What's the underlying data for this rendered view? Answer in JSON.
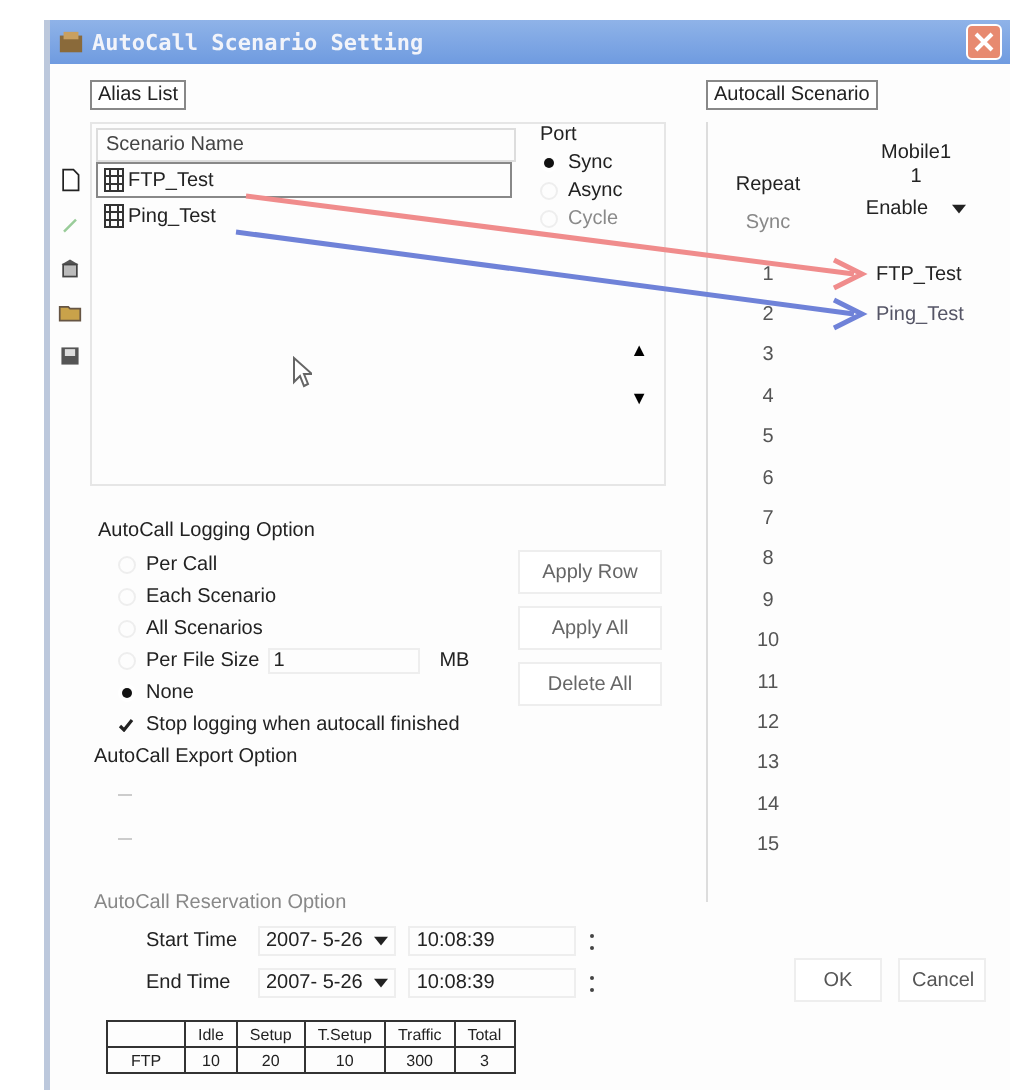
{
  "window": {
    "title": "AutoCall Scenario Setting"
  },
  "alias_list": {
    "label": "Alias List",
    "header": "Scenario Name",
    "items": [
      {
        "name": "FTP_Test",
        "selected": true
      },
      {
        "name": "Ping_Test",
        "selected": false
      }
    ]
  },
  "port": {
    "label": "Port",
    "options": [
      {
        "label": "Sync",
        "selected": true,
        "disabled": false
      },
      {
        "label": "Async",
        "selected": false,
        "disabled": false
      },
      {
        "label": "Cycle",
        "selected": false,
        "disabled": true
      }
    ]
  },
  "move_buttons": [
    "▲",
    "▼"
  ],
  "logging": {
    "title": "AutoCall Logging Option",
    "options": [
      {
        "label": "Per Call",
        "selected": false,
        "kind": "plain"
      },
      {
        "label": "Each Scenario",
        "selected": false,
        "kind": "plain"
      },
      {
        "label": "All Scenarios",
        "selected": false,
        "kind": "plain"
      },
      {
        "label": "Per File Size",
        "selected": false,
        "kind": "size"
      },
      {
        "label": "None",
        "selected": true,
        "kind": "plain"
      }
    ],
    "file_size": "1",
    "unit": "MB",
    "stop_logging": {
      "label": "Stop logging when autocall finished",
      "checked": true
    }
  },
  "row_buttons": [
    "Apply Row",
    "Apply All",
    "Delete All"
  ],
  "export": {
    "title": "AutoCall Export Option",
    "options": [
      {
        "selected": false
      },
      {
        "selected": false
      }
    ]
  },
  "reservation": {
    "title": "AutoCall Reservation Option",
    "rows": [
      {
        "label": "Start Time",
        "checked": false,
        "date": "2007- 5-26",
        "time": "10:08:39"
      },
      {
        "label": "End Time",
        "checked": false,
        "date": "2007- 5-26",
        "time": "10:08:39"
      }
    ]
  },
  "stats_table": {
    "columns": [
      "Idle",
      "Setup",
      "T.Setup",
      "Traffic",
      "Total"
    ],
    "rows": [
      {
        "label": "FTP",
        "cells": [
          "10",
          "20",
          "10",
          "300",
          "3"
        ]
      }
    ]
  },
  "scenario": {
    "label": "Autocall Scenario",
    "device": "Mobile1",
    "device_number": "1",
    "repeat_label": "Repeat",
    "mode": "Sync",
    "state": "Enable",
    "rows": [
      {
        "number": "1",
        "name": "FTP_Test"
      },
      {
        "number": "2",
        "name": "Ping_Test"
      },
      {
        "number": "3"
      },
      {
        "number": "4"
      },
      {
        "number": "5"
      },
      {
        "number": "6"
      },
      {
        "number": "7"
      },
      {
        "number": "8"
      },
      {
        "number": "9"
      },
      {
        "number": "10"
      },
      {
        "number": "11"
      },
      {
        "number": "12"
      },
      {
        "number": "13"
      },
      {
        "number": "14"
      },
      {
        "number": "15"
      }
    ]
  },
  "arrows": [
    {
      "color": "#f08c8c"
    },
    {
      "color": "#6f82d8"
    }
  ],
  "dialog_buttons": [
    "OK",
    "Cancel"
  ]
}
